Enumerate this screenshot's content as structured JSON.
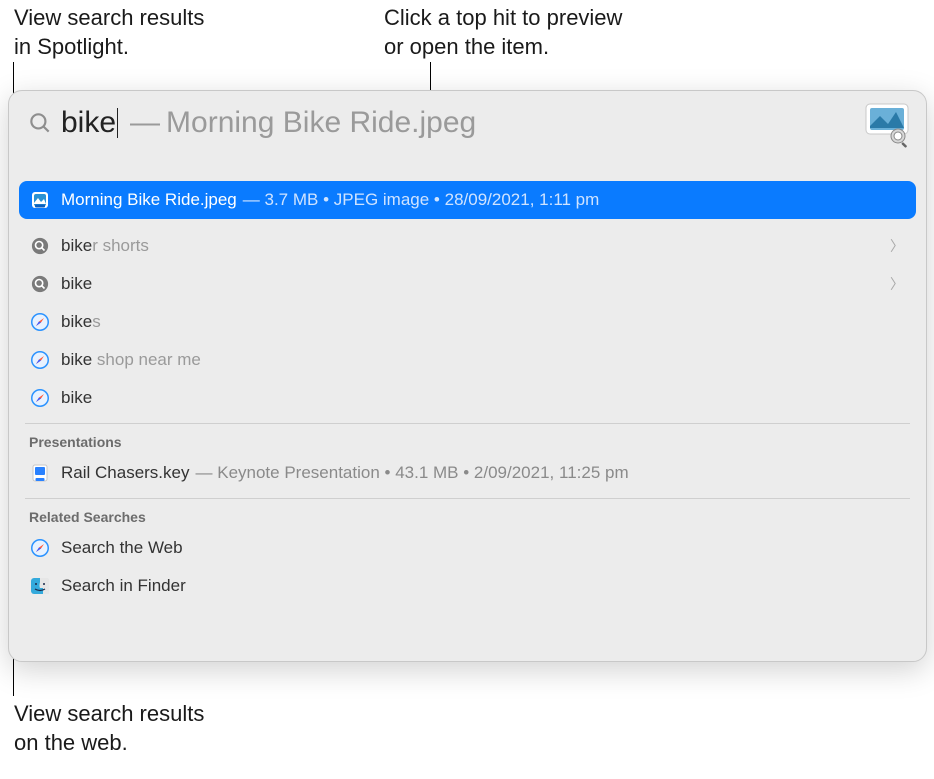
{
  "callouts": {
    "top_left_line1": "View search results",
    "top_left_line2": "in Spotlight.",
    "top_right_line1": "Click a top hit to preview",
    "top_right_line2": "or open the item.",
    "bottom_left_line1": "View search results",
    "bottom_left_line2": "on the web."
  },
  "search": {
    "query": "bike",
    "completion": "Morning Bike Ride.jpeg"
  },
  "top_hit": {
    "title": "Morning Bike Ride.jpeg",
    "size": "3.7 MB",
    "kind": "JPEG image",
    "date": "28/09/2021, 1:11 pm"
  },
  "suggestions": [
    {
      "match": "bike",
      "rest": "r shorts",
      "chevron": true,
      "icon": "magnify"
    },
    {
      "match": "bike",
      "rest": "",
      "chevron": true,
      "icon": "magnify"
    },
    {
      "match": "bike",
      "rest": "s",
      "chevron": false,
      "icon": "safari"
    },
    {
      "match": "bike",
      "rest": " shop near me",
      "chevron": false,
      "icon": "safari"
    },
    {
      "match": "bike",
      "rest": "",
      "chevron": false,
      "icon": "safari"
    }
  ],
  "sections": {
    "presentations_label": "Presentations",
    "related_label": "Related Searches"
  },
  "presentation": {
    "title": "Rail Chasers.key",
    "kind": "Keynote Presentation",
    "size": "43.1 MB",
    "date": "2/09/2021, 11:25 pm"
  },
  "related": {
    "web_label": "Search the Web",
    "finder_label": "Search in Finder"
  }
}
